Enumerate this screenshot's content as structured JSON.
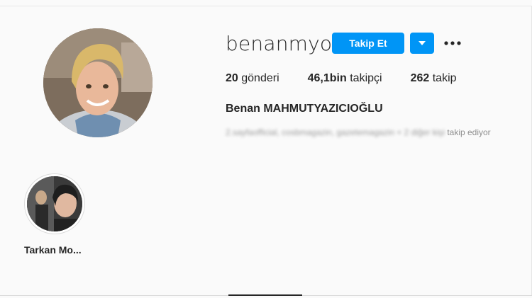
{
  "profile": {
    "username": "benanmyo",
    "follow_label": "Takip Et",
    "dropdown_icon": "caret-down-icon",
    "more_icon": "more-options-icon",
    "full_name": "Benan MAHMUTYAZICIOĞLU",
    "avatar": "profile-photo"
  },
  "stats": [
    {
      "value": "20",
      "label": "gönderi"
    },
    {
      "value": "46,1bin",
      "label": "takipçi"
    },
    {
      "value": "262",
      "label": "takip"
    }
  ],
  "followed_by": {
    "names_blurred": "2.sayfaofficial, cosbmagazin, gazetemagazin",
    "others": "+ 2 diğer kişi",
    "suffix": "takip ediyor"
  },
  "highlights": [
    {
      "label": "Tarkan Mo..."
    }
  ],
  "colors": {
    "accent": "#0095f6",
    "background": "#fafafa",
    "text": "#262626",
    "muted": "#8e8e8e"
  }
}
